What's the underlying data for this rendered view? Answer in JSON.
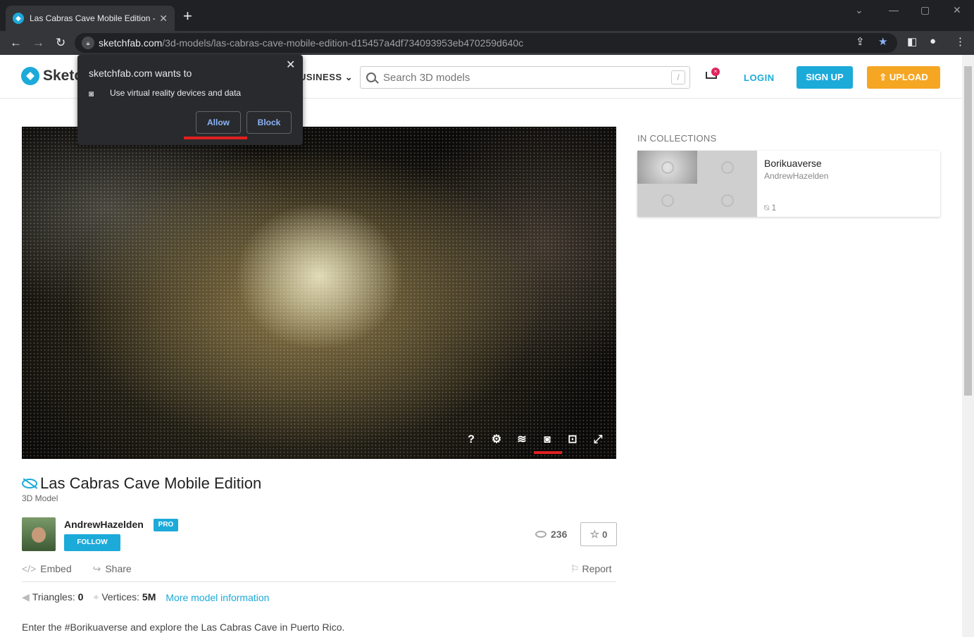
{
  "browser": {
    "tab_title": "Las Cabras Cave Mobile Edition -",
    "url_host": "sketchfab.com",
    "url_path": "/3d-models/las-cabras-cave-mobile-edition-d15457a4df734093953eb470259d640c"
  },
  "header": {
    "logo_text": "Sketc",
    "business_label": "USINESS",
    "search_placeholder": "Search 3D models",
    "search_shortcut": "/",
    "cart_badge": "×",
    "login": "LOGIN",
    "signup": "SIGN UP",
    "upload": "UPLOAD"
  },
  "permission": {
    "title": "sketchfab.com wants to",
    "description": "Use virtual reality devices and data",
    "allow": "Allow",
    "block": "Block"
  },
  "viewer": {
    "controls": [
      "?",
      "⚙",
      "≋",
      "◙",
      "⊡",
      "⤢"
    ]
  },
  "model": {
    "title": "Las Cabras Cave Mobile Edition",
    "subtitle": "3D Model",
    "author": "AndrewHazelden",
    "pro_badge": "PRO",
    "follow": "FOLLOW",
    "views": "236",
    "likes": "0",
    "embed": "Embed",
    "share": "Share",
    "report": "Report",
    "triangles_label": "Triangles:",
    "triangles_value": "0",
    "vertices_label": "Vertices:",
    "vertices_value": "5M",
    "more_info": "More model information",
    "description": "Enter the #Borikuaverse and explore the Las Cabras Cave in Puerto Rico."
  },
  "collections": {
    "heading": "IN COLLECTIONS",
    "items": [
      {
        "name": "Borikuaverse",
        "author": "AndrewHazelden",
        "count": "1"
      }
    ]
  }
}
